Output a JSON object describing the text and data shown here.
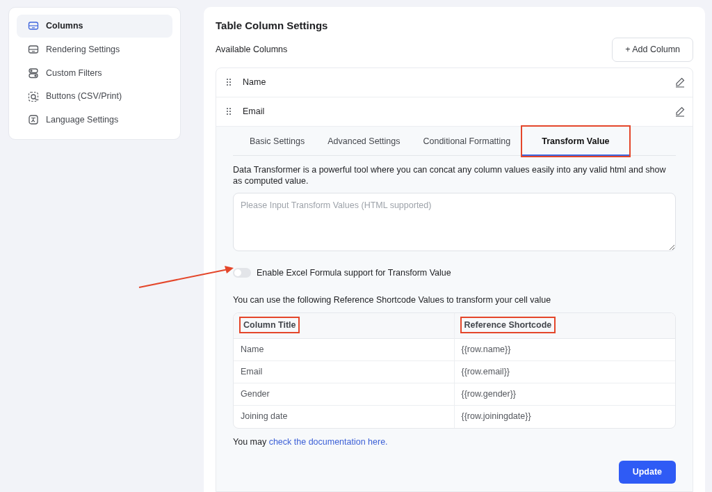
{
  "sidebar": {
    "items": [
      {
        "label": "Columns",
        "selected": true
      },
      {
        "label": "Rendering Settings",
        "selected": false
      },
      {
        "label": "Custom Filters",
        "selected": false
      },
      {
        "label": "Buttons (CSV/Print)",
        "selected": false
      },
      {
        "label": "Language Settings",
        "selected": false
      }
    ]
  },
  "main": {
    "title": "Table Column Settings",
    "subtitle": "Available Columns",
    "add_button": "+ Add Column",
    "columns": [
      {
        "label": "Name",
        "expanded": false
      },
      {
        "label": "Email",
        "expanded": true
      }
    ],
    "tabs": [
      {
        "label": "Basic Settings",
        "selected": false,
        "highlighted": false
      },
      {
        "label": "Advanced Settings",
        "selected": false,
        "highlighted": false
      },
      {
        "label": "Conditional Formatting",
        "selected": false,
        "highlighted": false
      },
      {
        "label": "Transform Value",
        "selected": true,
        "highlighted": true
      }
    ],
    "description": "Data Transformer is a powerful tool where you can concat any column values easily into any valid html and show as computed value.",
    "transform_field": {
      "placeholder": "Please Input Transform Values (HTML supported)"
    },
    "excel_toggle": {
      "label": "Enable Excel Formula support for Transform Value",
      "on": false,
      "pointed_at": true
    },
    "reference_intro": "You can use the following Reference Shortcode Values to transform your cell value",
    "table": {
      "columns": [
        {
          "label": "Column Title",
          "highlighted": true
        },
        {
          "label": "Reference Shortcode",
          "highlighted": true
        }
      ],
      "rows": [
        [
          "Name",
          "{{row.name}}"
        ],
        [
          "Email",
          "{{row.email}}"
        ],
        [
          "Gender",
          "{{row.gender}}"
        ],
        [
          "Joining date",
          "{{row.joiningdate}}"
        ]
      ]
    },
    "doc_note": {
      "text": "You may",
      "link": "check the documentation here."
    },
    "update_button": "Update"
  }
}
